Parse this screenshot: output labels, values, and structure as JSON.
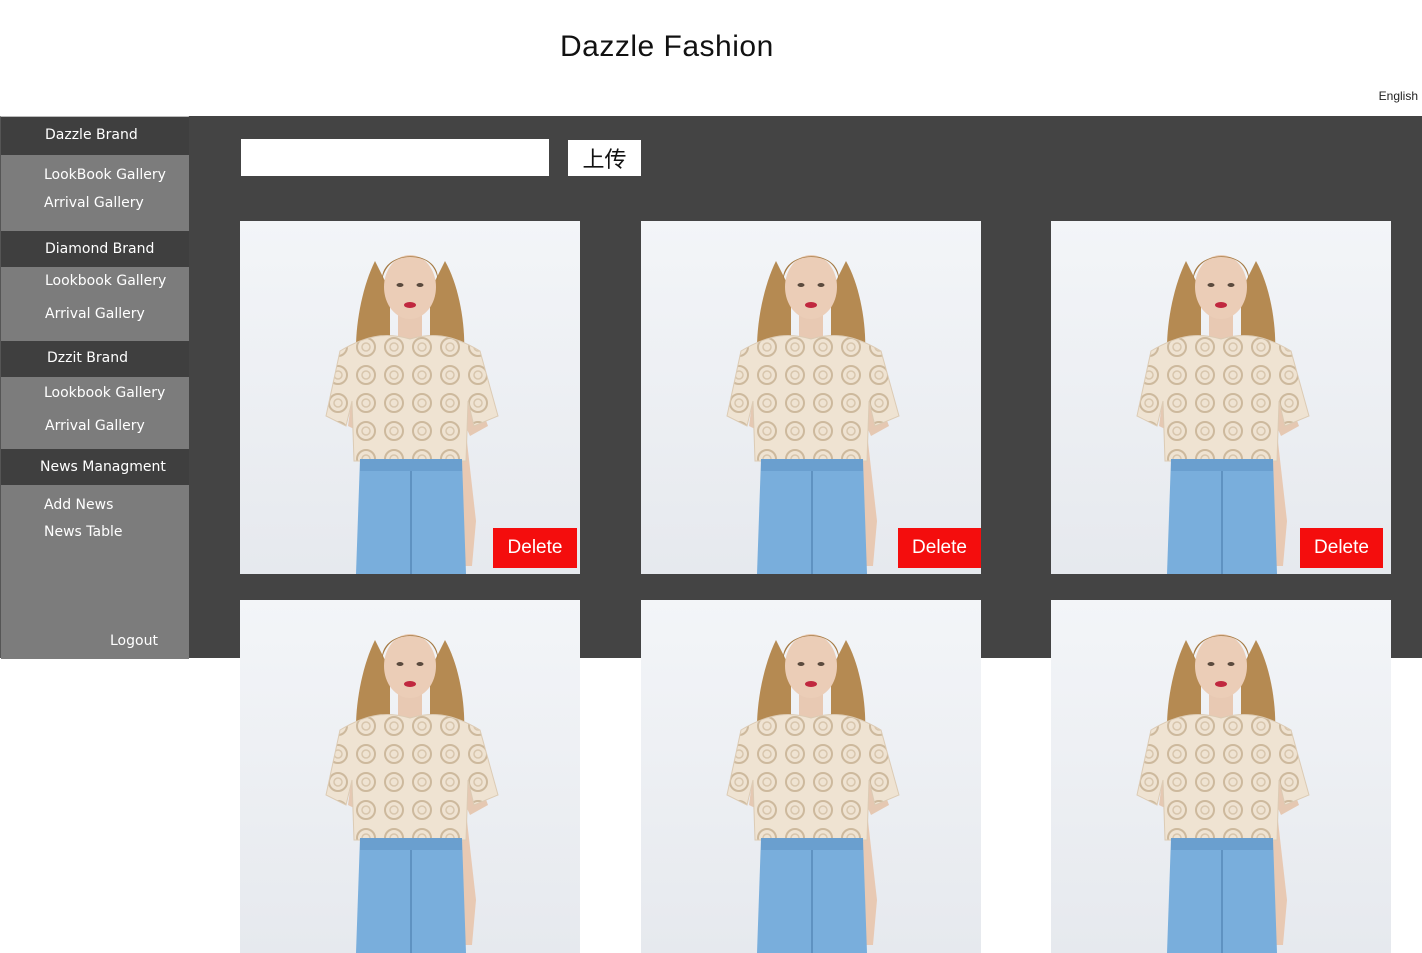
{
  "header": {
    "title": "Dazzle Fashion",
    "language": "English"
  },
  "sidebar": {
    "groups": [
      {
        "label": "Dazzle Brand",
        "items": [
          "LookBook Gallery",
          "Arrival Gallery"
        ]
      },
      {
        "label": "Diamond Brand",
        "items": [
          "Lookbook Gallery",
          "Arrival Gallery"
        ]
      },
      {
        "label": "Dzzit Brand",
        "items": [
          "Lookbook Gallery",
          "Arrival Gallery"
        ]
      },
      {
        "label": "News Managment",
        "items": [
          "Add News",
          "News Table"
        ]
      }
    ],
    "logout": "Logout"
  },
  "toolbar": {
    "search_value": "",
    "upload_label": "上传"
  },
  "gallery": {
    "delete_label": "Delete",
    "images": [
      "model-photo",
      "model-photo",
      "model-photo",
      "model-photo",
      "model-photo",
      "model-photo"
    ]
  },
  "colors": {
    "sidebar_head": "#3f3f3f",
    "sidebar_body": "#7c7c7c",
    "main_bg": "#444444",
    "delete": "#f40d0d"
  }
}
